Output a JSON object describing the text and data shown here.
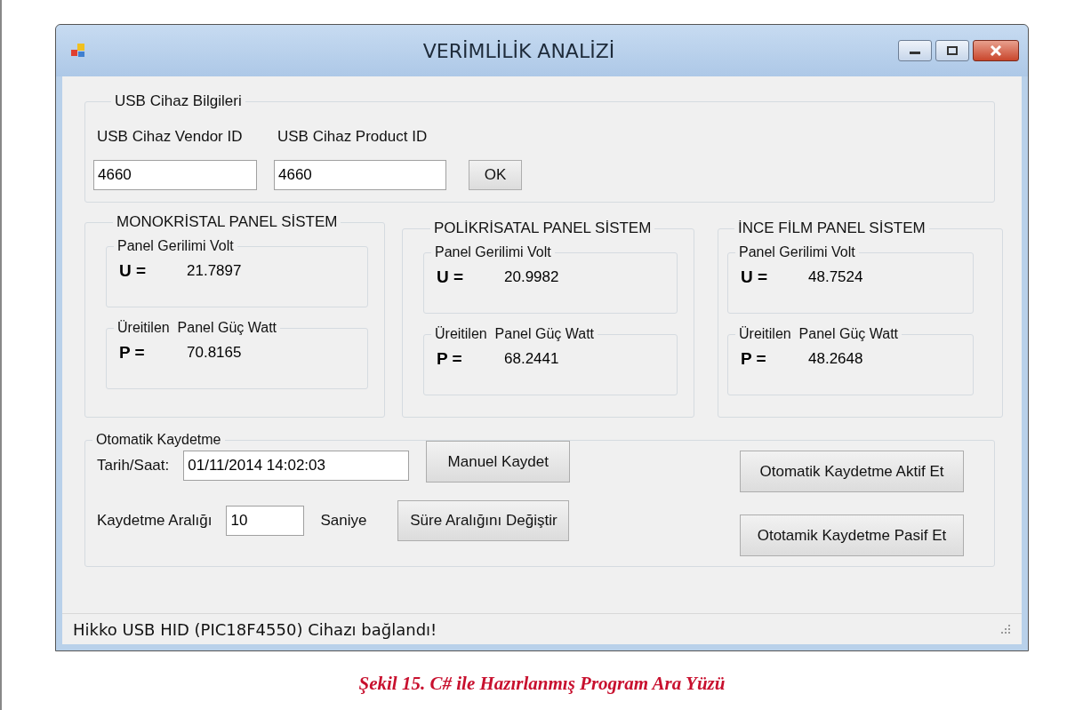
{
  "window": {
    "title": "VERİMLİLİK ANALİZİ"
  },
  "usb_group": {
    "legend": "USB Cihaz Bilgileri",
    "fields": [
      {
        "label": "USB Cihaz Vendor ID",
        "value": "4660"
      },
      {
        "label": "USB Cihaz Product ID",
        "value": "4660"
      }
    ],
    "button": "OK"
  },
  "panels": [
    {
      "title": "MONOKRİSTAL PANEL SİSTEM",
      "voltage": {
        "legend": "Panel Gerilimi Volt",
        "symbol": "U =",
        "value": "21.7897"
      },
      "power": {
        "legend": "Üreitilen  Panel Güç Watt",
        "symbol": "P =",
        "value": "70.8165"
      }
    },
    {
      "title": "POLİKRİSATAL PANEL SİSTEM",
      "voltage": {
        "legend": "Panel Gerilimi Volt",
        "symbol": "U =",
        "value": "20.9982"
      },
      "power": {
        "legend": "Üreitilen  Panel Güç Watt",
        "symbol": "P =",
        "value": "68.2441"
      }
    },
    {
      "title": "İNCE FİLM PANEL SİSTEM",
      "voltage": {
        "legend": "Panel Gerilimi Volt",
        "symbol": "U =",
        "value": "48.7524"
      },
      "power": {
        "legend": "Üreitilen  Panel Güç Watt",
        "symbol": "P =",
        "value": "48.2648"
      }
    }
  ],
  "auto_save": {
    "legend": "Otomatik Kaydetme",
    "datetime_label": "Tarih/Saat:",
    "datetime_value": "01/11/2014 14:02:03",
    "manual_button": "Manuel Kaydet",
    "interval_label": "Kaydetme Aralığı",
    "interval_value": "10",
    "interval_unit": "Saniye",
    "change_button": "Süre Aralığını Değiştir",
    "buttons": [
      "Otomatik Kaydetme Aktif Et",
      "Ototamik Kaydetme Pasif Et"
    ]
  },
  "status_bar": "Hikko USB HID (PIC18F4550) Cihazı bağlandı!",
  "caption": "Şekil 15. C# ile Hazırlanmış Program Ara Yüzü"
}
